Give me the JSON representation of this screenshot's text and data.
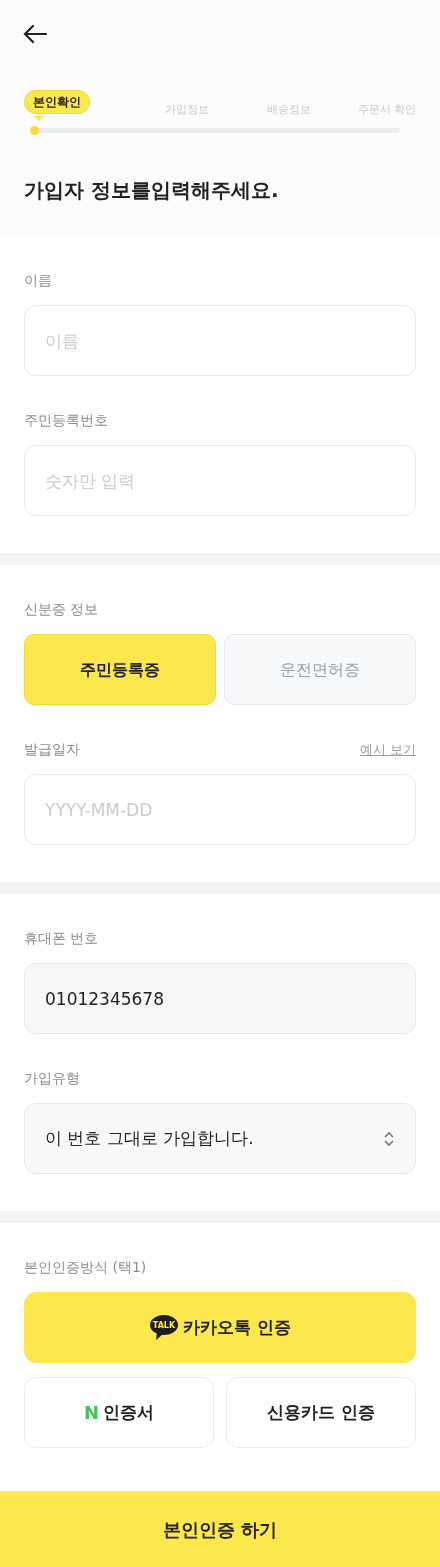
{
  "steps": [
    {
      "label": "본인확인",
      "selected": true
    },
    {
      "label": "가입정보",
      "selected": false
    },
    {
      "label": "배송정보",
      "selected": false
    },
    {
      "label": "주문서 확인",
      "selected": false
    }
  ],
  "title": "가입자 정보를입력해주세요.",
  "sections": [
    {
      "fields": [
        {
          "kind": "input",
          "label": "이름",
          "placeholder": "이름"
        },
        {
          "kind": "input",
          "label": "주민등록번호",
          "placeholder": "숫자만 입력"
        }
      ]
    },
    {
      "fields": [
        {
          "kind": "choice",
          "label": "신분증 정보",
          "options": [
            {
              "label": "주민등록증",
              "selected": true
            },
            {
              "label": "운전면허증",
              "selected": false
            }
          ]
        },
        {
          "kind": "input",
          "label": "발급일자",
          "link": "예시 보기",
          "placeholder": "YYYY-MM-DD"
        }
      ]
    },
    {
      "fields": [
        {
          "kind": "filled",
          "label": "휴대폰 번호",
          "value": "01012345678"
        },
        {
          "kind": "select",
          "label": "가입유형",
          "value": "이 번호 그대로 가입합니다."
        }
      ]
    },
    {
      "fields": [
        {
          "kind": "methods",
          "label": "본인인증방식 (택1)",
          "methods": [
            {
              "kind": "kakao",
              "badge": "TALK",
              "label": "카카오톡 인증"
            },
            {
              "kind": "naver",
              "badge": "N",
              "label": "인증서"
            },
            {
              "kind": "card",
              "label": "신용카드 인증"
            }
          ]
        }
      ]
    }
  ],
  "submit": "본인인증 하기"
}
